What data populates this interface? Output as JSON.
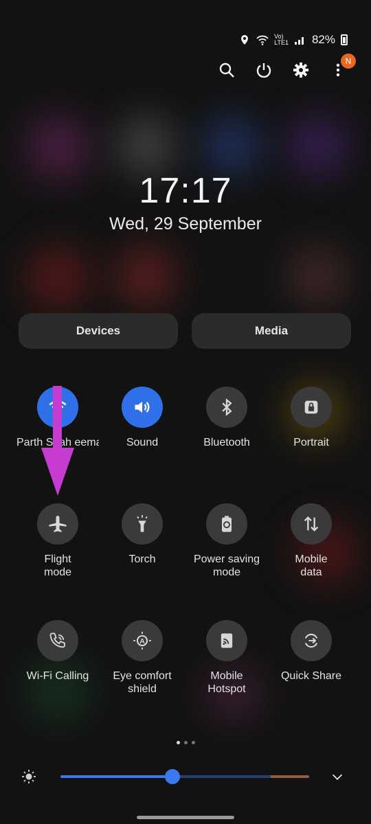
{
  "status_bar": {
    "battery": "82%"
  },
  "top_actions": {
    "badge": "N"
  },
  "clock": {
    "time": "17:17",
    "date": "Wed, 29 September"
  },
  "pills": {
    "devices": "Devices",
    "media": "Media"
  },
  "tiles": [
    {
      "label": "Parth Shah eemas",
      "on": true,
      "icon": "wifi-icon"
    },
    {
      "label": "Sound",
      "on": true,
      "icon": "speaker-icon"
    },
    {
      "label": "Bluetooth",
      "on": false,
      "icon": "bluetooth-icon"
    },
    {
      "label": "Portrait",
      "on": false,
      "icon": "lock-rotation-icon"
    },
    {
      "label": "Flight mode",
      "on": false,
      "icon": "airplane-icon"
    },
    {
      "label": "Torch",
      "on": false,
      "icon": "torch-icon"
    },
    {
      "label": "Power saving mode",
      "on": false,
      "icon": "battery-saver-icon"
    },
    {
      "label": "Mobile data",
      "on": false,
      "icon": "mobile-data-icon"
    },
    {
      "label": "Wi-Fi Calling",
      "on": false,
      "icon": "wifi-calling-icon"
    },
    {
      "label": "Eye comfort shield",
      "on": false,
      "icon": "eye-comfort-icon"
    },
    {
      "label": "Mobile Hotspot",
      "on": false,
      "icon": "hotspot-icon"
    },
    {
      "label": "Quick Share",
      "on": false,
      "icon": "quick-share-icon"
    }
  ],
  "brightness": {
    "level": 0.45
  },
  "colors": {
    "accent": "#3b79f2",
    "badge": "#e8661f",
    "arrow": "#c63bd0"
  }
}
